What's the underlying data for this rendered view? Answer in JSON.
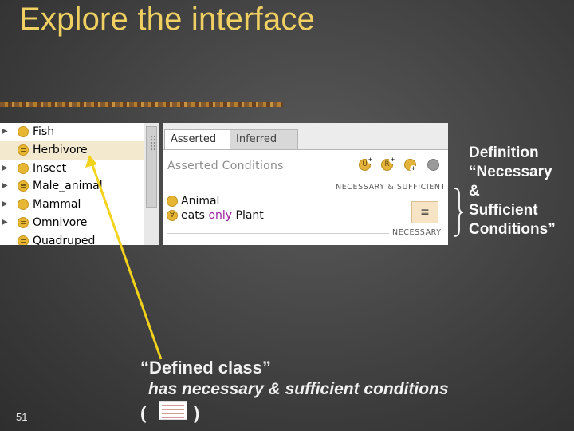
{
  "slide": {
    "title": "Explore the interface",
    "number": "51"
  },
  "class_list": {
    "items": [
      {
        "label": "Fish",
        "expandable": true,
        "defined": false,
        "selected": false
      },
      {
        "label": "Herbivore",
        "expandable": false,
        "defined": true,
        "selected": true
      },
      {
        "label": "Insect",
        "expandable": true,
        "defined": false,
        "selected": false
      },
      {
        "label": "Male_animal",
        "expandable": true,
        "defined": true,
        "selected": false
      },
      {
        "label": "Mammal",
        "expandable": true,
        "defined": false,
        "selected": false
      },
      {
        "label": "Omnivore",
        "expandable": true,
        "defined": true,
        "selected": false
      },
      {
        "label": "Quadruped",
        "expandable": false,
        "defined": true,
        "selected": false
      }
    ]
  },
  "conditions_panel": {
    "tabs": [
      {
        "label": "Asserted",
        "active": true
      },
      {
        "label": "Inferred",
        "active": false
      }
    ],
    "header": "Asserted Conditions",
    "tool_icons": [
      "add-named-class-icon",
      "add-restriction-icon",
      "add-class-icon",
      "settings-icon"
    ],
    "section_necessary_sufficient": "NECESSARY & SUFFICIENT",
    "section_necessary": "NECESSARY",
    "equivalence_symbol": "≡",
    "conditions": [
      {
        "text": "Animal",
        "icon": "named-class-icon"
      },
      {
        "prefix": "eats ",
        "keyword": "only",
        "suffix": " Plant",
        "icon": "restriction-icon"
      }
    ]
  },
  "annotation": {
    "definition_text": "Definition\n“Necessary\n  &\nSufficient\nConditions”"
  },
  "caption": {
    "line1": "“Defined class”",
    "line2": "has necessary & sufficient conditions",
    "open_paren": "(",
    "close_paren": ")"
  },
  "colors": {
    "title": "#f0d060",
    "accent_arrow": "#f2d21a",
    "class_icon": "#e7b733",
    "keyword": "#9c1fa0",
    "selected_row": "#f3e9cf"
  }
}
